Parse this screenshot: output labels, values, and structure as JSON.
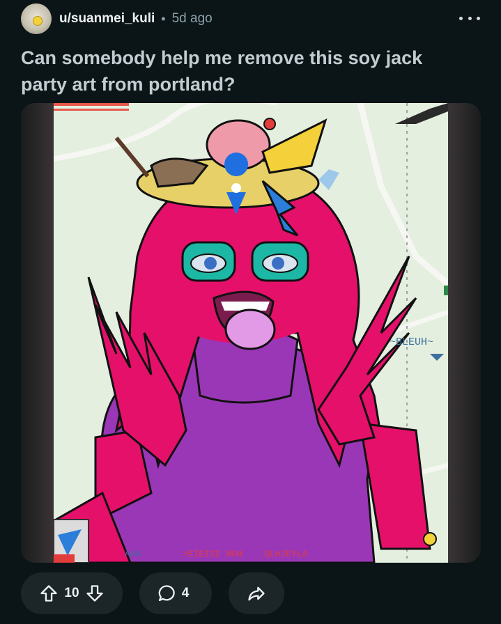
{
  "post": {
    "username": "u/suanmei_kuli",
    "separator": "•",
    "time": "5d ago",
    "title": "Can somebody help me remove this soy jack party art from portland?"
  },
  "image": {
    "caption_right": "~BLEUH~",
    "bottom_text_1": "AAA",
    "bottom_text_2": ">EIEISI NOH",
    "bottom_text_3": "QLHJEYLA"
  },
  "actions": {
    "upvotes": "10",
    "comments": "4"
  },
  "colors": {
    "background": "#0b1416",
    "pill": "#1c2628",
    "hair": "#e5106a",
    "sweater": "#9a37b7",
    "map": "#e4efdf"
  }
}
